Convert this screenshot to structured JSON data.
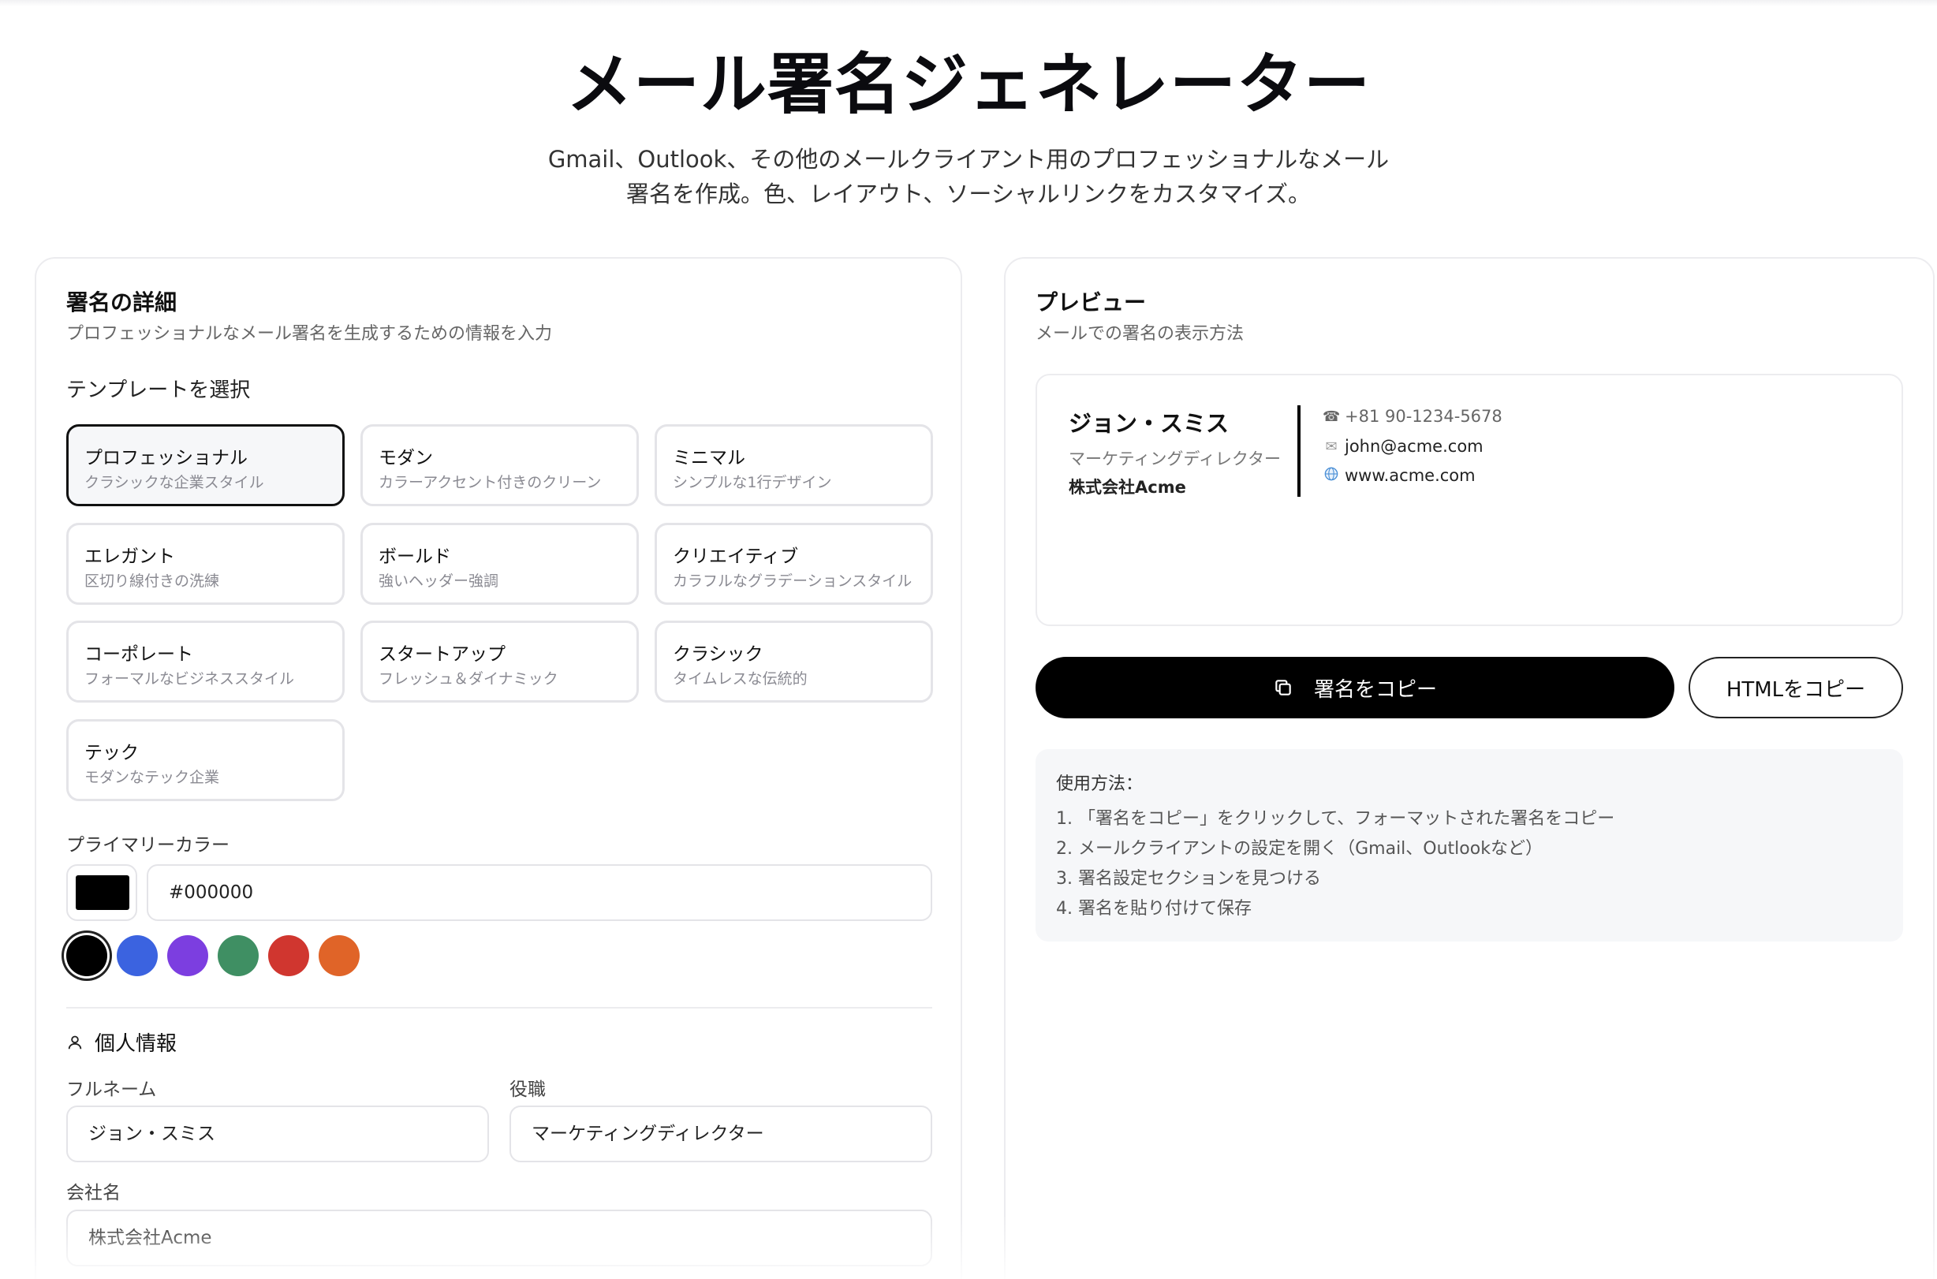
{
  "header": {
    "title": "メール署名ジェネレーター",
    "subtitle": "Gmail、Outlook、その他のメールクライアント用のプロフェッショナルなメール署名を作成。色、レイアウト、ソーシャルリンクをカスタマイズ。"
  },
  "details": {
    "title": "署名の詳細",
    "description": "プロフェッショナルなメール署名を生成するための情報を入力",
    "template_label": "テンプレートを選択",
    "templates": [
      {
        "name": "プロフェッショナル",
        "desc": "クラシックな企業スタイル",
        "selected": true
      },
      {
        "name": "モダン",
        "desc": "カラーアクセント付きのクリーン",
        "selected": false
      },
      {
        "name": "ミニマル",
        "desc": "シンプルな1行デザイン",
        "selected": false
      },
      {
        "name": "エレガント",
        "desc": "区切り線付きの洗練",
        "selected": false
      },
      {
        "name": "ボールド",
        "desc": "強いヘッダー強調",
        "selected": false
      },
      {
        "name": "クリエイティブ",
        "desc": "カラフルなグラデーションスタイル",
        "selected": false
      },
      {
        "name": "コーポレート",
        "desc": "フォーマルなビジネススタイル",
        "selected": false
      },
      {
        "name": "スタートアップ",
        "desc": "フレッシュ＆ダイナミック",
        "selected": false
      },
      {
        "name": "クラシック",
        "desc": "タイムレスな伝統的",
        "selected": false
      },
      {
        "name": "テック",
        "desc": "モダンなテック企業",
        "selected": false
      }
    ],
    "color_label": "プライマリーカラー",
    "color_value": "#000000",
    "presets": [
      "#000000",
      "#3b63e0",
      "#7c3ee0",
      "#3f8f63",
      "#d0362f",
      "#e06428"
    ],
    "personal_label": "個人情報",
    "fullname_label": "フルネーム",
    "fullname_value": "ジョン・スミス",
    "role_label": "役職",
    "role_value": "マーケティングディレクター",
    "company_label": "会社名",
    "company_value": "株式会社Acme"
  },
  "preview": {
    "title": "プレビュー",
    "description": "メールでの署名の表示方法",
    "signature": {
      "name": "ジョン・スミス",
      "role": "マーケティングディレクター",
      "company": "株式会社Acme",
      "phone": "+81 90-1234-5678",
      "email": "john@acme.com",
      "website": "www.acme.com"
    },
    "copy_button": "署名をコピー",
    "copy_html_button": "HTMLをコピー",
    "howto_title": "使用方法：",
    "howto_steps": [
      "1. 「署名をコピー」をクリックして、フォーマットされた署名をコピー",
      "2. メールクライアントの設定を開く（Gmail、Outlookなど）",
      "3. 署名設定セクションを見つける",
      "4. 署名を貼り付けて保存"
    ]
  }
}
